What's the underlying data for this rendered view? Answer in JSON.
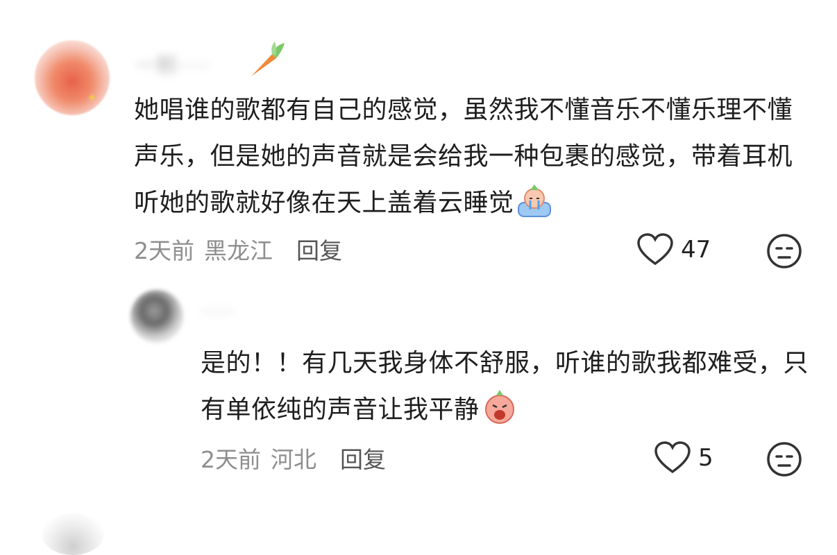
{
  "comments": [
    {
      "text": "她唱谁的歌都有自己的感觉，虽然我不懂音乐不懂乐理不懂声乐，但是她的声音就是会给我一种包裹的感觉，带着耳机听她的歌就好像在天上盖着云睡觉",
      "emoji": "crying-bed-emoji",
      "time": "2天前",
      "location": "黑龙江",
      "reply_label": "回复",
      "likes": "47"
    },
    {
      "text": "是的！！有几天我身体不舒服，听谁的歌我都难受，只有单依纯的声音让我平静",
      "emoji": "shocked-face-emoji",
      "time": "2天前",
      "location": "河北",
      "reply_label": "回复",
      "likes": "5"
    }
  ],
  "icons": {
    "like": "heart-outline-icon",
    "dislike": "meh-face-icon",
    "username_decoration": "carrot-icon"
  },
  "colors": {
    "text": "#1e1e1e",
    "meta": "#8e8e8e",
    "reply": "#555555"
  }
}
